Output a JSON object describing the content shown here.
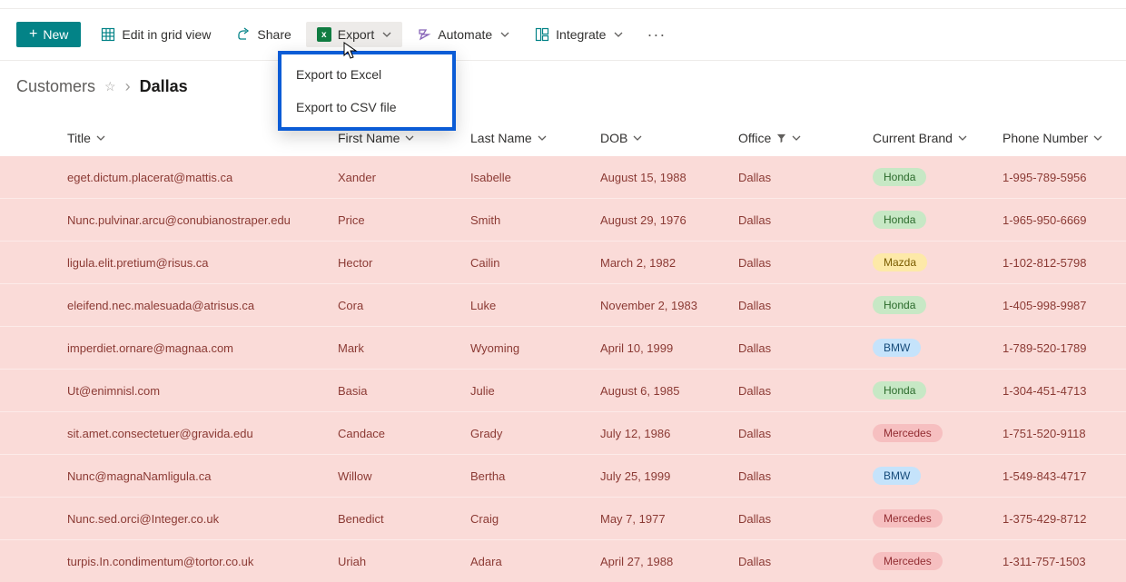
{
  "toolbar": {
    "new_label": "New",
    "edit_label": "Edit in grid view",
    "share_label": "Share",
    "export_label": "Export",
    "automate_label": "Automate",
    "integrate_label": "Integrate"
  },
  "export_menu": {
    "to_excel": "Export to Excel",
    "to_csv": "Export to CSV file"
  },
  "breadcrumb": {
    "root": "Customers",
    "current": "Dallas"
  },
  "columns": {
    "title": "Title",
    "first_name": "First Name",
    "last_name": "Last Name",
    "dob": "DOB",
    "office": "Office",
    "brand": "Current Brand",
    "phone": "Phone Number"
  },
  "rows": [
    {
      "title": "eget.dictum.placerat@mattis.ca",
      "first_name": "Xander",
      "last_name": "Isabelle",
      "dob": "August 15, 1988",
      "office": "Dallas",
      "brand": "Honda",
      "phone": "1-995-789-5956"
    },
    {
      "title": "Nunc.pulvinar.arcu@conubianostraper.edu",
      "first_name": "Price",
      "last_name": "Smith",
      "dob": "August 29, 1976",
      "office": "Dallas",
      "brand": "Honda",
      "phone": "1-965-950-6669"
    },
    {
      "title": "ligula.elit.pretium@risus.ca",
      "first_name": "Hector",
      "last_name": "Cailin",
      "dob": "March 2, 1982",
      "office": "Dallas",
      "brand": "Mazda",
      "phone": "1-102-812-5798"
    },
    {
      "title": "eleifend.nec.malesuada@atrisus.ca",
      "first_name": "Cora",
      "last_name": "Luke",
      "dob": "November 2, 1983",
      "office": "Dallas",
      "brand": "Honda",
      "phone": "1-405-998-9987"
    },
    {
      "title": "imperdiet.ornare@magnaa.com",
      "first_name": "Mark",
      "last_name": "Wyoming",
      "dob": "April 10, 1999",
      "office": "Dallas",
      "brand": "BMW",
      "phone": "1-789-520-1789"
    },
    {
      "title": "Ut@enimnisl.com",
      "first_name": "Basia",
      "last_name": "Julie",
      "dob": "August 6, 1985",
      "office": "Dallas",
      "brand": "Honda",
      "phone": "1-304-451-4713"
    },
    {
      "title": "sit.amet.consectetuer@gravida.edu",
      "first_name": "Candace",
      "last_name": "Grady",
      "dob": "July 12, 1986",
      "office": "Dallas",
      "brand": "Mercedes",
      "phone": "1-751-520-9118"
    },
    {
      "title": "Nunc@magnaNamligula.ca",
      "first_name": "Willow",
      "last_name": "Bertha",
      "dob": "July 25, 1999",
      "office": "Dallas",
      "brand": "BMW",
      "phone": "1-549-843-4717"
    },
    {
      "title": "Nunc.sed.orci@Integer.co.uk",
      "first_name": "Benedict",
      "last_name": "Craig",
      "dob": "May 7, 1977",
      "office": "Dallas",
      "brand": "Mercedes",
      "phone": "1-375-429-8712"
    },
    {
      "title": "turpis.In.condimentum@tortor.co.uk",
      "first_name": "Uriah",
      "last_name": "Adara",
      "dob": "April 27, 1988",
      "office": "Dallas",
      "brand": "Mercedes",
      "phone": "1-311-757-1503"
    }
  ]
}
